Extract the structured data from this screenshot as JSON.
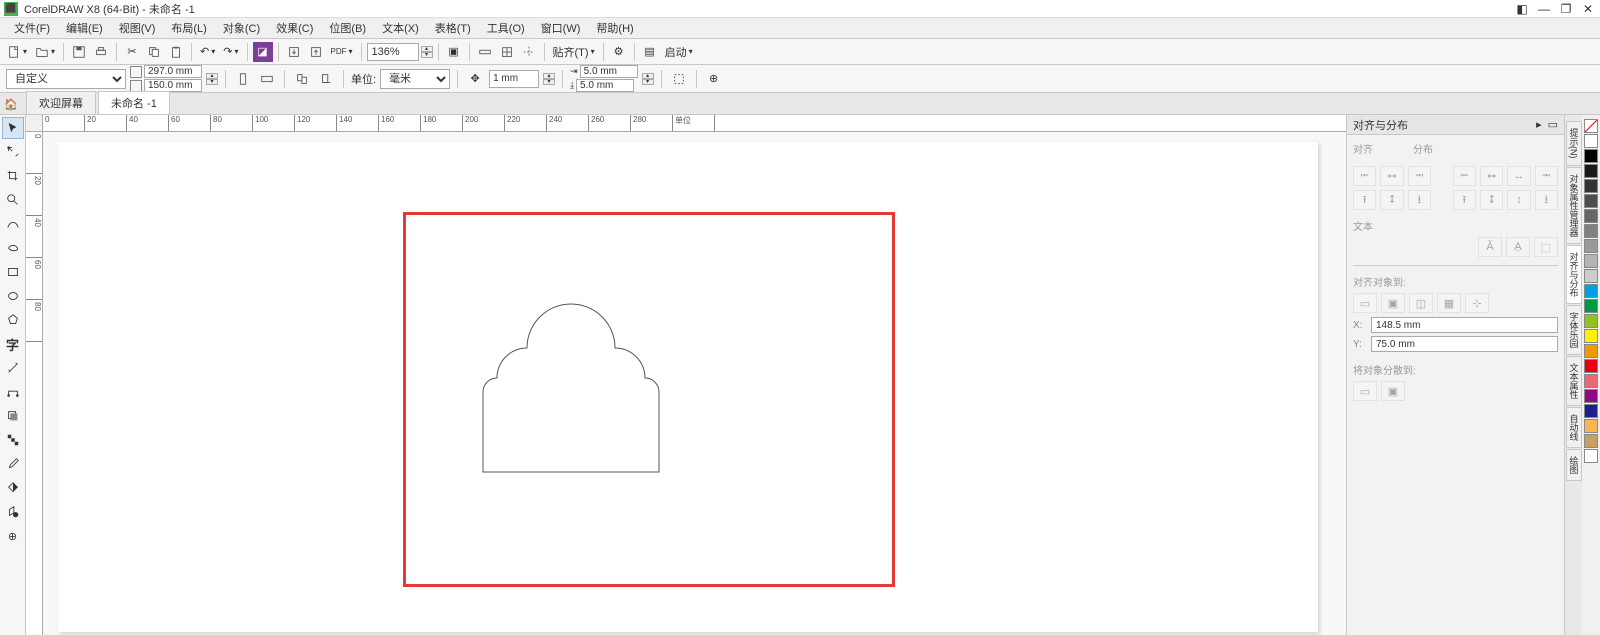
{
  "title": "CorelDRAW X8 (64-Bit) - 未命名 -1",
  "menu": [
    "文件(F)",
    "编辑(E)",
    "视图(V)",
    "布局(L)",
    "对象(C)",
    "效果(C)",
    "位图(B)",
    "文本(X)",
    "表格(T)",
    "工具(O)",
    "窗口(W)",
    "帮助(H)"
  ],
  "toolbar": {
    "zoom": "136%",
    "snap": "贴齐(T)",
    "launch": "启动"
  },
  "prop": {
    "preset": "自定义",
    "page_w": "297.0 mm",
    "page_h": "150.0 mm",
    "units_label": "单位:",
    "units_value": "毫米",
    "nudge": "1 mm",
    "dup_x": "5.0 mm",
    "dup_y": "5.0 mm"
  },
  "tabs": {
    "welcome": "欢迎屏幕",
    "doc": "未命名 -1"
  },
  "ruler_h": [
    "0",
    "20",
    "40",
    "60",
    "80",
    "100",
    "120",
    "140",
    "160",
    "180",
    "200",
    "220",
    "240",
    "260",
    "280",
    "单位"
  ],
  "ruler_v": [
    "0",
    "20",
    "40",
    "60",
    "80"
  ],
  "docker": {
    "title": "对齐与分布",
    "align_label": "对齐",
    "dist_label": "分布",
    "text_label": "文本",
    "target_label": "对齐对象到:",
    "x_val": "148.5 mm",
    "y_val": "75.0 mm",
    "dist_to_label": "将对象分散到:"
  },
  "right_tabs": [
    "提示(N)",
    "对象属性管理器",
    "对齐与分布",
    "字体乐园",
    "文本属性",
    "自动线",
    "绘图"
  ],
  "colors": [
    "#ffffff",
    "#000000",
    "#1a1a1a",
    "#333333",
    "#4d4d4d",
    "#666666",
    "#808080",
    "#999999",
    "#b3b3b3",
    "#cccccc",
    "#00a0e9",
    "#009944",
    "#8fc31f",
    "#fff100",
    "#f39800",
    "#e60012",
    "#eb6877",
    "#920783",
    "#1d2088",
    "#f8b551",
    "#c9a063",
    "#ffffff"
  ]
}
